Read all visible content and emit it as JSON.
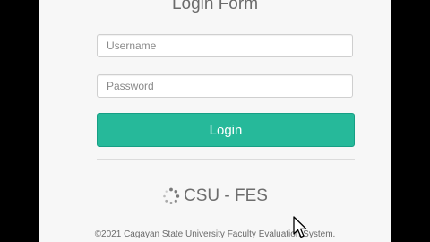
{
  "form": {
    "title": "Login Form",
    "username_placeholder": "Username",
    "password_placeholder": "Password",
    "login_label": "Login"
  },
  "brand": {
    "icon": "spinner-icon",
    "name": "CSU - FES"
  },
  "footer": {
    "text": "©2021 Cagayan State University Faculty Evaluation System."
  },
  "colors": {
    "accent": "#26b99a",
    "panel_bg": "#f7f7f7",
    "outer_bg": "#000000"
  }
}
